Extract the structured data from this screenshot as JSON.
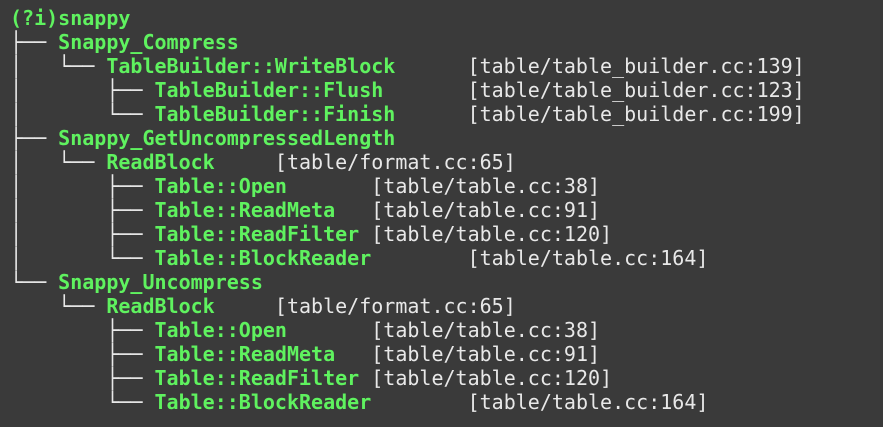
{
  "terminal": {
    "lines": [
      {
        "prefix": "",
        "name": "(?i)snappy",
        "pad": "",
        "loc": ""
      },
      {
        "prefix": "├── ",
        "name": "Snappy_Compress",
        "pad": "",
        "loc": ""
      },
      {
        "prefix": "│   └── ",
        "name": "TableBuilder::WriteBlock",
        "pad": "      ",
        "loc": "[table/table_builder.cc:139]"
      },
      {
        "prefix": "│       ├── ",
        "name": "TableBuilder::Flush",
        "pad": "       ",
        "loc": "[table/table_builder.cc:123]"
      },
      {
        "prefix": "│       └── ",
        "name": "TableBuilder::Finish",
        "pad": "      ",
        "loc": "[table/table_builder.cc:199]"
      },
      {
        "prefix": "├── ",
        "name": "Snappy_GetUncompressedLength",
        "pad": "",
        "loc": ""
      },
      {
        "prefix": "│   └── ",
        "name": "ReadBlock",
        "pad": "     ",
        "loc": "[table/format.cc:65]"
      },
      {
        "prefix": "│       ├── ",
        "name": "Table::Open",
        "pad": "       ",
        "loc": "[table/table.cc:38]"
      },
      {
        "prefix": "│       ├── ",
        "name": "Table::ReadMeta",
        "pad": "   ",
        "loc": "[table/table.cc:91]"
      },
      {
        "prefix": "│       ├── ",
        "name": "Table::ReadFilter",
        "pad": " ",
        "loc": "[table/table.cc:120]"
      },
      {
        "prefix": "│       └── ",
        "name": "Table::BlockReader",
        "pad": "        ",
        "loc": "[table/table.cc:164]"
      },
      {
        "prefix": "└── ",
        "name": "Snappy_Uncompress",
        "pad": "",
        "loc": ""
      },
      {
        "prefix": "    └── ",
        "name": "ReadBlock",
        "pad": "     ",
        "loc": "[table/format.cc:65]"
      },
      {
        "prefix": "        ├── ",
        "name": "Table::Open",
        "pad": "       ",
        "loc": "[table/table.cc:38]"
      },
      {
        "prefix": "        ├── ",
        "name": "Table::ReadMeta",
        "pad": "   ",
        "loc": "[table/table.cc:91]"
      },
      {
        "prefix": "        ├── ",
        "name": "Table::ReadFilter",
        "pad": " ",
        "loc": "[table/table.cc:120]"
      },
      {
        "prefix": "        └── ",
        "name": "Table::BlockReader",
        "pad": "        ",
        "loc": "[table/table.cc:164]"
      }
    ]
  },
  "colors": {
    "background": "#3a3a3a",
    "function": "#5ff25f",
    "text": "#e8e8e8"
  }
}
